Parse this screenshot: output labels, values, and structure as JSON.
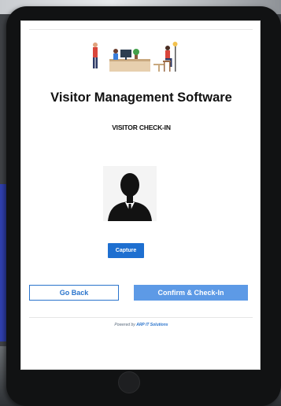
{
  "app": {
    "title": "Visitor Management Software",
    "subtitle": "VISITOR CHECK-IN"
  },
  "banner": {
    "icon": "office-reception-illustration"
  },
  "avatar": {
    "icon": "user-silhouette-icon"
  },
  "buttons": {
    "capture_label": "Capture",
    "go_back_label": "Go Back",
    "confirm_label": "Confirm & Check-In"
  },
  "footer": {
    "prefix": "Powered by",
    "brand": "ARP IT Solutions"
  },
  "colors": {
    "primary": "#1e6fd0",
    "confirm": "#5d9ae6",
    "tablet_frame": "#111213"
  }
}
